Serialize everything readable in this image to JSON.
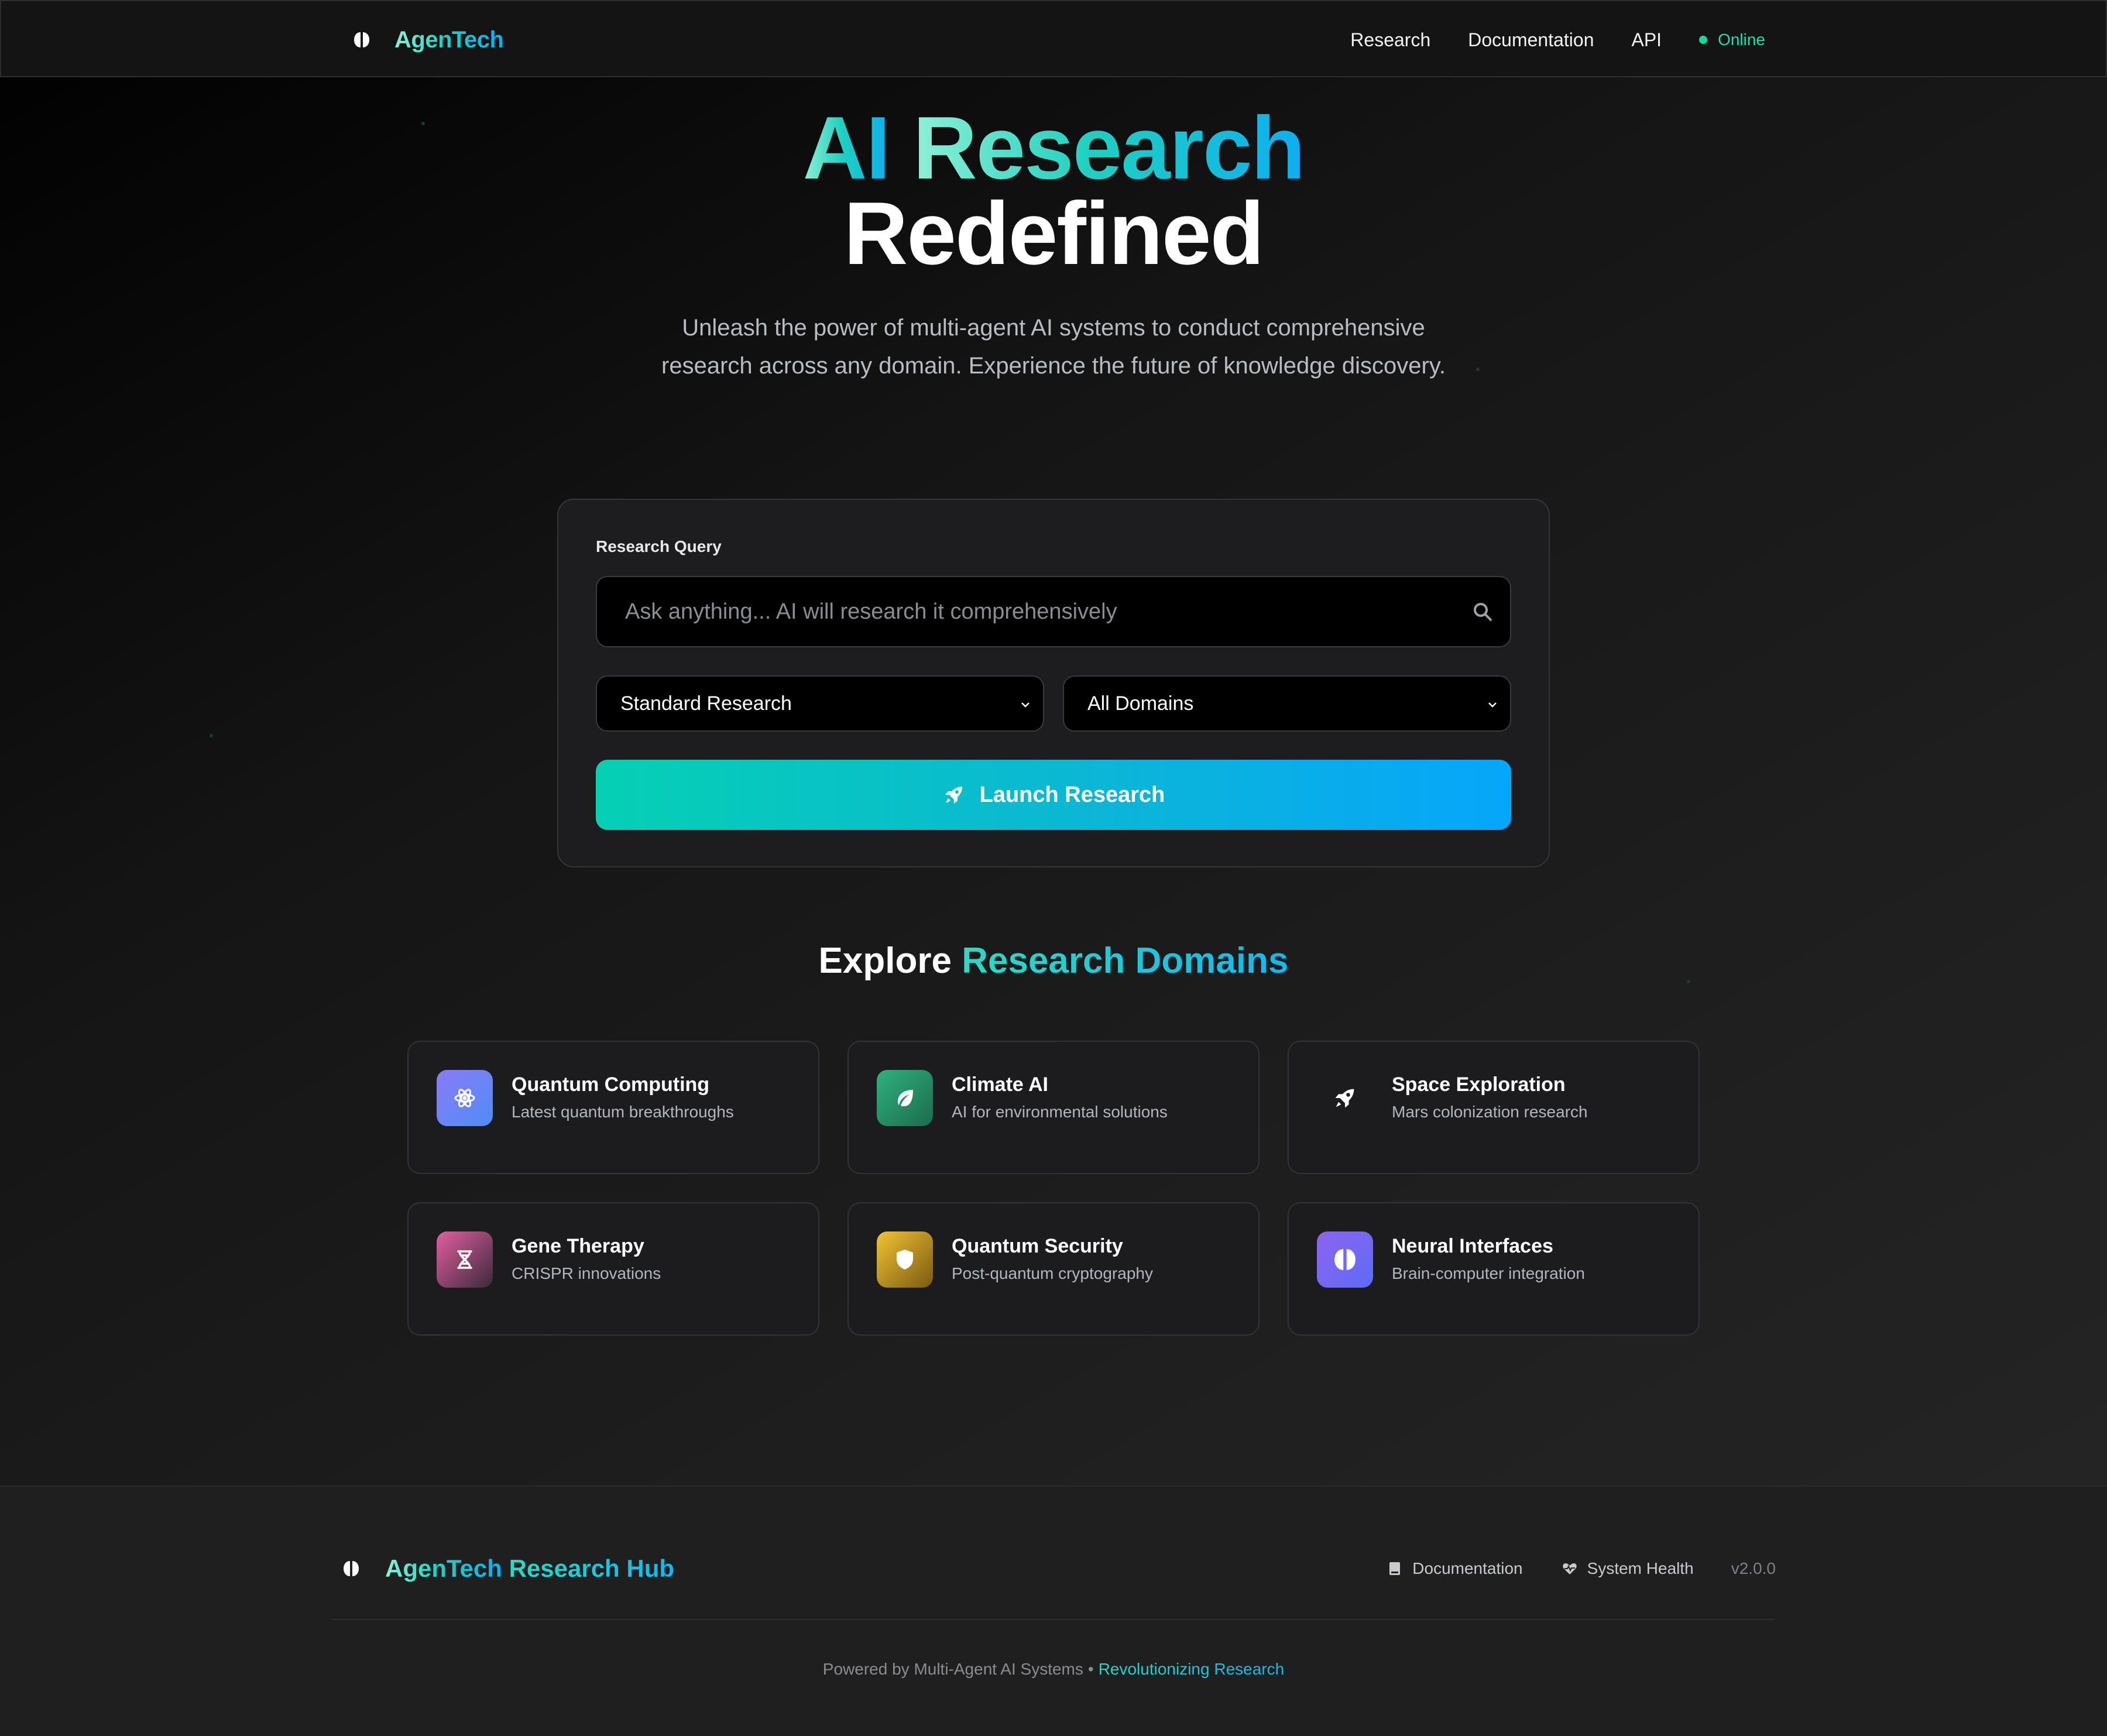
{
  "nav": {
    "brand": "AgenTech",
    "links": [
      "Research",
      "Documentation",
      "API"
    ],
    "status": "Online"
  },
  "hero": {
    "title_line1_a": "AI",
    "title_line1_b": "Research",
    "title_line2": "Redefined",
    "subtitle": "Unleash the power of multi-agent AI systems to conduct comprehensive research across any domain. Experience the future of knowledge discovery."
  },
  "search": {
    "label": "Research Query",
    "placeholder": "Ask anything... AI will research it comprehensively",
    "mode_selected": "Standard Research",
    "domain_selected": "All Domains",
    "launch_label": "Launch Research"
  },
  "domains": {
    "title_a": "Explore",
    "title_b": "Research Domains",
    "items": [
      {
        "title": "Quantum Computing",
        "desc": "Latest quantum breakthroughs",
        "icon": "atom-icon"
      },
      {
        "title": "Climate AI",
        "desc": "AI for environmental solutions",
        "icon": "leaf-icon"
      },
      {
        "title": "Space Exploration",
        "desc": "Mars colonization research",
        "icon": "rocket-icon"
      },
      {
        "title": "Gene Therapy",
        "desc": "CRISPR innovations",
        "icon": "dna-icon"
      },
      {
        "title": "Quantum Security",
        "desc": "Post-quantum cryptography",
        "icon": "shield-icon"
      },
      {
        "title": "Neural Interfaces",
        "desc": "Brain-computer integration",
        "icon": "brain-icon"
      }
    ]
  },
  "footer": {
    "brand_a": "AgenTech",
    "brand_b": "Research Hub",
    "links": [
      "Documentation",
      "System Health"
    ],
    "version": "v2.0.0",
    "powered": "Powered by Multi-Agent AI Systems",
    "separator": "•",
    "tagline": "Revolutionizing Research"
  },
  "colors": {
    "accent_teal": "#1fd0c0",
    "accent_blue": "#0ea5f0",
    "status_green": "#10d9a4"
  }
}
